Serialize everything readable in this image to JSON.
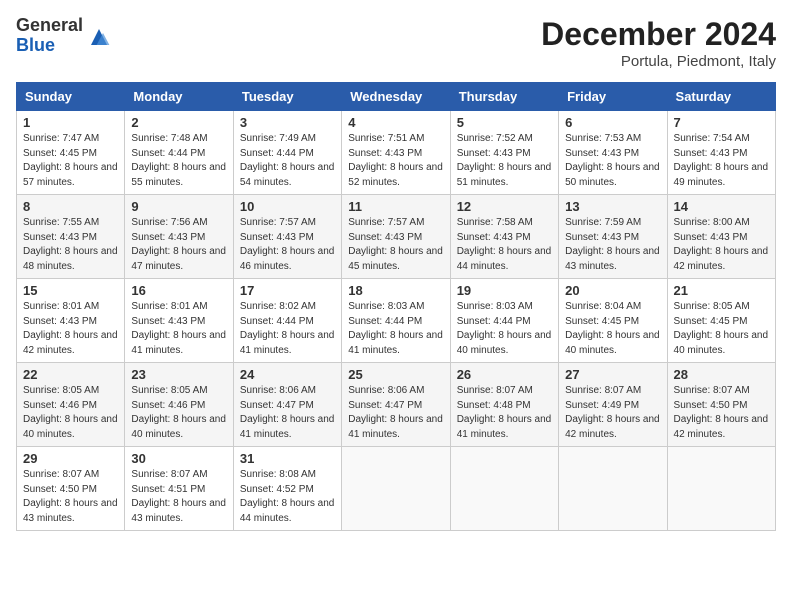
{
  "header": {
    "logo_general": "General",
    "logo_blue": "Blue",
    "month_title": "December 2024",
    "location": "Portula, Piedmont, Italy"
  },
  "weekdays": [
    "Sunday",
    "Monday",
    "Tuesday",
    "Wednesday",
    "Thursday",
    "Friday",
    "Saturday"
  ],
  "weeks": [
    [
      {
        "day": "1",
        "sunrise": "Sunrise: 7:47 AM",
        "sunset": "Sunset: 4:45 PM",
        "daylight": "Daylight: 8 hours and 57 minutes."
      },
      {
        "day": "2",
        "sunrise": "Sunrise: 7:48 AM",
        "sunset": "Sunset: 4:44 PM",
        "daylight": "Daylight: 8 hours and 55 minutes."
      },
      {
        "day": "3",
        "sunrise": "Sunrise: 7:49 AM",
        "sunset": "Sunset: 4:44 PM",
        "daylight": "Daylight: 8 hours and 54 minutes."
      },
      {
        "day": "4",
        "sunrise": "Sunrise: 7:51 AM",
        "sunset": "Sunset: 4:43 PM",
        "daylight": "Daylight: 8 hours and 52 minutes."
      },
      {
        "day": "5",
        "sunrise": "Sunrise: 7:52 AM",
        "sunset": "Sunset: 4:43 PM",
        "daylight": "Daylight: 8 hours and 51 minutes."
      },
      {
        "day": "6",
        "sunrise": "Sunrise: 7:53 AM",
        "sunset": "Sunset: 4:43 PM",
        "daylight": "Daylight: 8 hours and 50 minutes."
      },
      {
        "day": "7",
        "sunrise": "Sunrise: 7:54 AM",
        "sunset": "Sunset: 4:43 PM",
        "daylight": "Daylight: 8 hours and 49 minutes."
      }
    ],
    [
      {
        "day": "8",
        "sunrise": "Sunrise: 7:55 AM",
        "sunset": "Sunset: 4:43 PM",
        "daylight": "Daylight: 8 hours and 48 minutes."
      },
      {
        "day": "9",
        "sunrise": "Sunrise: 7:56 AM",
        "sunset": "Sunset: 4:43 PM",
        "daylight": "Daylight: 8 hours and 47 minutes."
      },
      {
        "day": "10",
        "sunrise": "Sunrise: 7:57 AM",
        "sunset": "Sunset: 4:43 PM",
        "daylight": "Daylight: 8 hours and 46 minutes."
      },
      {
        "day": "11",
        "sunrise": "Sunrise: 7:57 AM",
        "sunset": "Sunset: 4:43 PM",
        "daylight": "Daylight: 8 hours and 45 minutes."
      },
      {
        "day": "12",
        "sunrise": "Sunrise: 7:58 AM",
        "sunset": "Sunset: 4:43 PM",
        "daylight": "Daylight: 8 hours and 44 minutes."
      },
      {
        "day": "13",
        "sunrise": "Sunrise: 7:59 AM",
        "sunset": "Sunset: 4:43 PM",
        "daylight": "Daylight: 8 hours and 43 minutes."
      },
      {
        "day": "14",
        "sunrise": "Sunrise: 8:00 AM",
        "sunset": "Sunset: 4:43 PM",
        "daylight": "Daylight: 8 hours and 42 minutes."
      }
    ],
    [
      {
        "day": "15",
        "sunrise": "Sunrise: 8:01 AM",
        "sunset": "Sunset: 4:43 PM",
        "daylight": "Daylight: 8 hours and 42 minutes."
      },
      {
        "day": "16",
        "sunrise": "Sunrise: 8:01 AM",
        "sunset": "Sunset: 4:43 PM",
        "daylight": "Daylight: 8 hours and 41 minutes."
      },
      {
        "day": "17",
        "sunrise": "Sunrise: 8:02 AM",
        "sunset": "Sunset: 4:44 PM",
        "daylight": "Daylight: 8 hours and 41 minutes."
      },
      {
        "day": "18",
        "sunrise": "Sunrise: 8:03 AM",
        "sunset": "Sunset: 4:44 PM",
        "daylight": "Daylight: 8 hours and 41 minutes."
      },
      {
        "day": "19",
        "sunrise": "Sunrise: 8:03 AM",
        "sunset": "Sunset: 4:44 PM",
        "daylight": "Daylight: 8 hours and 40 minutes."
      },
      {
        "day": "20",
        "sunrise": "Sunrise: 8:04 AM",
        "sunset": "Sunset: 4:45 PM",
        "daylight": "Daylight: 8 hours and 40 minutes."
      },
      {
        "day": "21",
        "sunrise": "Sunrise: 8:05 AM",
        "sunset": "Sunset: 4:45 PM",
        "daylight": "Daylight: 8 hours and 40 minutes."
      }
    ],
    [
      {
        "day": "22",
        "sunrise": "Sunrise: 8:05 AM",
        "sunset": "Sunset: 4:46 PM",
        "daylight": "Daylight: 8 hours and 40 minutes."
      },
      {
        "day": "23",
        "sunrise": "Sunrise: 8:05 AM",
        "sunset": "Sunset: 4:46 PM",
        "daylight": "Daylight: 8 hours and 40 minutes."
      },
      {
        "day": "24",
        "sunrise": "Sunrise: 8:06 AM",
        "sunset": "Sunset: 4:47 PM",
        "daylight": "Daylight: 8 hours and 41 minutes."
      },
      {
        "day": "25",
        "sunrise": "Sunrise: 8:06 AM",
        "sunset": "Sunset: 4:47 PM",
        "daylight": "Daylight: 8 hours and 41 minutes."
      },
      {
        "day": "26",
        "sunrise": "Sunrise: 8:07 AM",
        "sunset": "Sunset: 4:48 PM",
        "daylight": "Daylight: 8 hours and 41 minutes."
      },
      {
        "day": "27",
        "sunrise": "Sunrise: 8:07 AM",
        "sunset": "Sunset: 4:49 PM",
        "daylight": "Daylight: 8 hours and 42 minutes."
      },
      {
        "day": "28",
        "sunrise": "Sunrise: 8:07 AM",
        "sunset": "Sunset: 4:50 PM",
        "daylight": "Daylight: 8 hours and 42 minutes."
      }
    ],
    [
      {
        "day": "29",
        "sunrise": "Sunrise: 8:07 AM",
        "sunset": "Sunset: 4:50 PM",
        "daylight": "Daylight: 8 hours and 43 minutes."
      },
      {
        "day": "30",
        "sunrise": "Sunrise: 8:07 AM",
        "sunset": "Sunset: 4:51 PM",
        "daylight": "Daylight: 8 hours and 43 minutes."
      },
      {
        "day": "31",
        "sunrise": "Sunrise: 8:08 AM",
        "sunset": "Sunset: 4:52 PM",
        "daylight": "Daylight: 8 hours and 44 minutes."
      },
      null,
      null,
      null,
      null
    ]
  ]
}
